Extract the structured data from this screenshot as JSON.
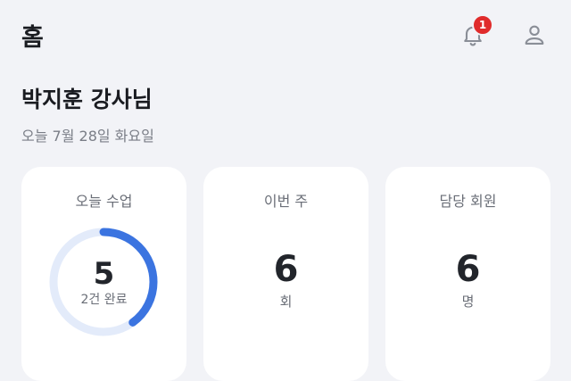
{
  "header": {
    "title": "홈",
    "notification_count": "1",
    "notification_icon": "bell-icon",
    "profile_icon": "user-icon"
  },
  "greeting": "박지훈 강사님",
  "date": "오늘 7월 28일 화요일",
  "colors": {
    "background": "#f2f3f7",
    "accent": "#3b74e0",
    "accent_track": "#e3ebfa",
    "badge": "#e02b2b"
  },
  "cards": [
    {
      "label": "오늘 수업",
      "value": "5",
      "sub": "2건 완료",
      "progress": 0.4
    },
    {
      "label": "이번 주",
      "value": "6",
      "sub": "회"
    },
    {
      "label": "담당 회원",
      "value": "6",
      "sub": "명"
    }
  ]
}
